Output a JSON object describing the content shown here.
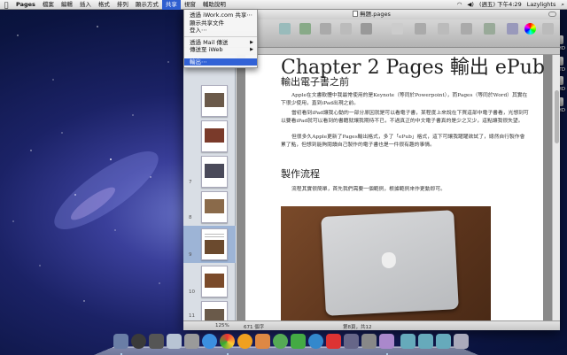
{
  "menubar": {
    "apple": "",
    "app_name": "Pages",
    "menus": [
      "檔案",
      "編輯",
      "插入",
      "格式",
      "排列",
      "顯示方式",
      "共享",
      "視窗",
      "輔助說明"
    ],
    "active_menu": "共享",
    "clock": "(週五) 下午4:29",
    "user": "Lazylights"
  },
  "share_menu": {
    "items": [
      {
        "label": "透過 iWork.com 共享⋯",
        "submenu": false
      },
      {
        "label": "顯示共享文件",
        "submenu": false
      },
      {
        "label": "登入⋯",
        "submenu": false
      },
      {
        "label": "透過 Mail 傳送",
        "submenu": true
      },
      {
        "label": "傳送至 iWeb",
        "submenu": true
      },
      {
        "label": "輸出⋯",
        "submenu": false,
        "highlighted": true
      }
    ]
  },
  "window": {
    "title": "無題.pages"
  },
  "document": {
    "title": "Chapter 2 Pages 輸出 ePub",
    "section1_heading": "輸出電子書之前",
    "para1": "Apple在文書軟體中我最常使用的是Keynote（等同於Powerpoint），而Pages（等同於Word）其實在下很少使用，直到iPad出現之前。",
    "para2": "當初看到iPad讓我心動的一部分原因就是可以看電子書，某程度上來說在下買這部中電子書看，光想到可以要看iPad就可以看到的書籍就讓我期待不已，不過真正的中文電子書真的是少之又少，這點讓我很失望。",
    "para3": "但很多久Apple更新了Pages輸出格式，多了「ePub」格式，這下可讓我躍躍欲試了，總然自行製作會累了點，但想到能夠閱讀自己製作的電子書也是一件很有趣的事情。",
    "section2_heading": "製作流程",
    "para4": "流程其實很簡單，首先我們需要一個範例，根據範例來作更動即可。"
  },
  "sidebar": {
    "page_numbers": [
      "7",
      "8",
      "9",
      "10",
      "11"
    ]
  },
  "statusbar": {
    "zoom": "125%",
    "words": "671 個字",
    "page_info": "第8頁，共12"
  },
  "desktop": {
    "disks": [
      "HD",
      "TD",
      "HD",
      "HD"
    ]
  }
}
